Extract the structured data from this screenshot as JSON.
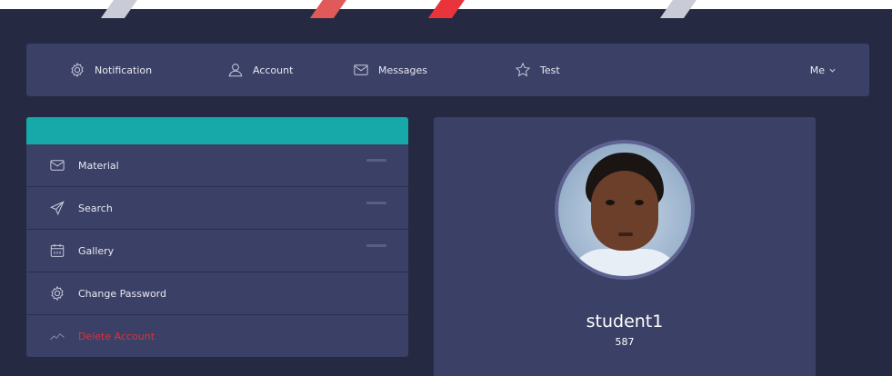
{
  "colors": {
    "background": "#252a42",
    "panel": "#3b4066",
    "accent": "#17a9a9",
    "danger": "#e0303a"
  },
  "nav": {
    "items": [
      {
        "label": "Notification",
        "icon": "gear-icon"
      },
      {
        "label": "Account",
        "icon": "user-icon"
      },
      {
        "label": "Messages",
        "icon": "envelope-icon"
      },
      {
        "label": "Test",
        "icon": "star-icon"
      }
    ],
    "user_menu": "Me",
    "user_menu_icon": "chevron-down-icon"
  },
  "sidebar": {
    "items": [
      {
        "label": "Material",
        "icon": "envelope-icon"
      },
      {
        "label": "Search",
        "icon": "send-icon"
      },
      {
        "label": "Gallery",
        "icon": "calendar-icon"
      },
      {
        "label": "Change Password",
        "icon": "gear-icon"
      },
      {
        "label": "Delete Account",
        "icon": "chart-icon"
      }
    ]
  },
  "profile": {
    "username": "student1",
    "id": "587"
  }
}
